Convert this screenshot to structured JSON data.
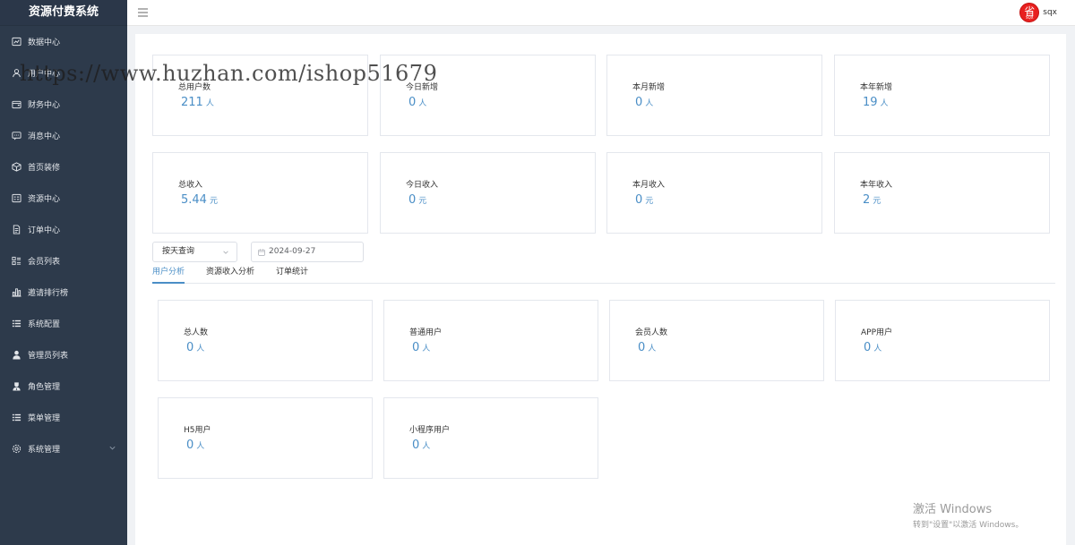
{
  "app": {
    "title": "资源付费系统"
  },
  "sidebar": {
    "items": [
      {
        "label": "数据中心",
        "icon": "dashboard-icon"
      },
      {
        "label": "用户中心",
        "icon": "user-icon"
      },
      {
        "label": "财务中心",
        "icon": "wallet-icon"
      },
      {
        "label": "消息中心",
        "icon": "message-icon"
      },
      {
        "label": "首页装修",
        "icon": "cube-icon"
      },
      {
        "label": "资源中心",
        "icon": "resource-icon"
      },
      {
        "label": "订单中心",
        "icon": "document-icon"
      },
      {
        "label": "会员列表",
        "icon": "grid-list-icon"
      },
      {
        "label": "邀请排行榜",
        "icon": "bar-chart-icon"
      },
      {
        "label": "系统配置",
        "icon": "list-icon"
      },
      {
        "label": "管理员列表",
        "icon": "person-icon"
      },
      {
        "label": "角色管理",
        "icon": "role-icon"
      },
      {
        "label": "菜单管理",
        "icon": "menu-list-icon"
      },
      {
        "label": "系统管理",
        "icon": "gear-icon"
      }
    ]
  },
  "header": {
    "user": {
      "name": "sqx",
      "avatar_text": "省",
      "avatar_sub": "SQX"
    }
  },
  "stats_users": [
    {
      "label": "总用户数",
      "value": "211",
      "unit": "人"
    },
    {
      "label": "今日新增",
      "value": "0",
      "unit": "人"
    },
    {
      "label": "本月新增",
      "value": "0",
      "unit": "人"
    },
    {
      "label": "本年新增",
      "value": "19",
      "unit": "人"
    }
  ],
  "stats_income": [
    {
      "label": "总收入",
      "value": "5.44",
      "unit": "元"
    },
    {
      "label": "今日收入",
      "value": "0",
      "unit": "元"
    },
    {
      "label": "本月收入",
      "value": "0",
      "unit": "元"
    },
    {
      "label": "本年收入",
      "value": "2",
      "unit": "元"
    }
  ],
  "filter": {
    "mode": "按天查询",
    "date": "2024-09-27"
  },
  "tabs": [
    {
      "label": "用户分析",
      "active": true
    },
    {
      "label": "资源收入分析",
      "active": false
    },
    {
      "label": "订单统计",
      "active": false
    }
  ],
  "user_analysis": [
    {
      "label": "总人数",
      "value": "0",
      "unit": "人"
    },
    {
      "label": "普通用户",
      "value": "0",
      "unit": "人"
    },
    {
      "label": "会员人数",
      "value": "0",
      "unit": "人"
    },
    {
      "label": "APP用户",
      "value": "0",
      "unit": "人"
    },
    {
      "label": "H5用户",
      "value": "0",
      "unit": "人"
    },
    {
      "label": "小程序用户",
      "value": "0",
      "unit": "人"
    }
  ],
  "watermark": {
    "url": "https://www.huzhan.com/ishop51679"
  },
  "windows_activation": {
    "line1": "激活 Windows",
    "line2": "转到\"设置\"以激活 Windows。"
  },
  "colors": {
    "sidebar_bg": "#2d3a4b",
    "accent": "#4a8ec6",
    "avatar_red": "#e8201f"
  }
}
